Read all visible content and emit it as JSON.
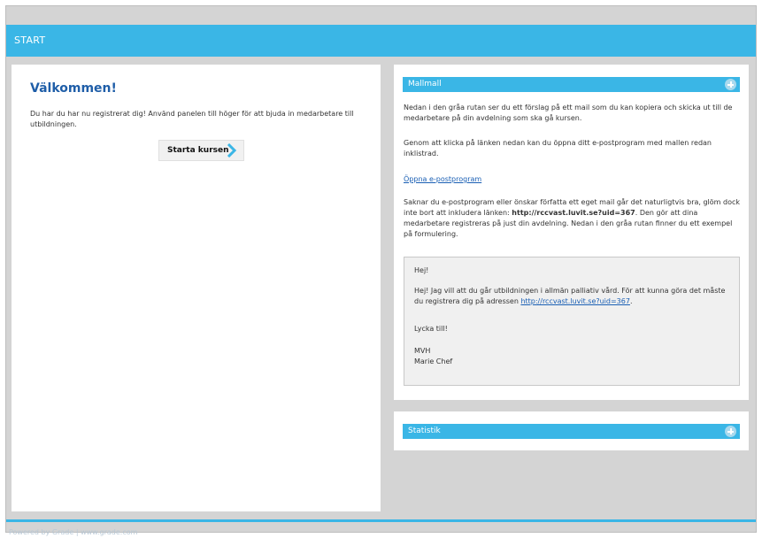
{
  "header": {
    "title": "START"
  },
  "welcome": {
    "title": "Välkommen!",
    "text": "Du har du har nu registrerat dig! Använd panelen till höger för att bjuda in medarbetare till utbildningen.",
    "button_label": "Starta kursen"
  },
  "mailmall": {
    "title": "Mallmall",
    "para1": "Nedan i den gråa rutan ser du ett förslag på ett mail som du kan kopiera och skicka ut till de medarbetare på din avdelning som ska gå kursen.",
    "para2": "Genom att klicka på länken nedan kan du öppna ditt e-postprogram med mallen redan inklistrad.",
    "open_link": "Öppna e-postprogram",
    "para3_before": "Saknar du e-postprogram eller önskar författa ett eget mail går det naturligtvis bra, glöm dock inte bort att inkludera länken:",
    "para3_url": "http://rccvast.luvit.se?uid=367",
    "para3_after": ". Den gör att dina medarbetare registreras på just din avdelning. Nedan i den gråa rutan finner du ett exempel på formulering.",
    "template": {
      "greeting": "Hej!",
      "body_before": "Hej! Jag vill att du går utbildningen i allmän palliativ vård. För att kunna göra det måste du registrera dig på adressen",
      "body_link": "http://rccvast.luvit.se?uid=367",
      "body_after": ".",
      "wish": "Lycka till!",
      "sign1": "MVH",
      "sign2": "Marie Chef"
    }
  },
  "statistik": {
    "title": "Statistik"
  },
  "footer": {
    "text": "Powered by Grade | www.grade.com"
  },
  "colors": {
    "accent": "#3ab6e6",
    "title_blue": "#1f5ea8",
    "background": "#d4d4d4"
  },
  "icons": {
    "expand": "plus-circle-icon",
    "arrow": "chevron-right-icon"
  }
}
